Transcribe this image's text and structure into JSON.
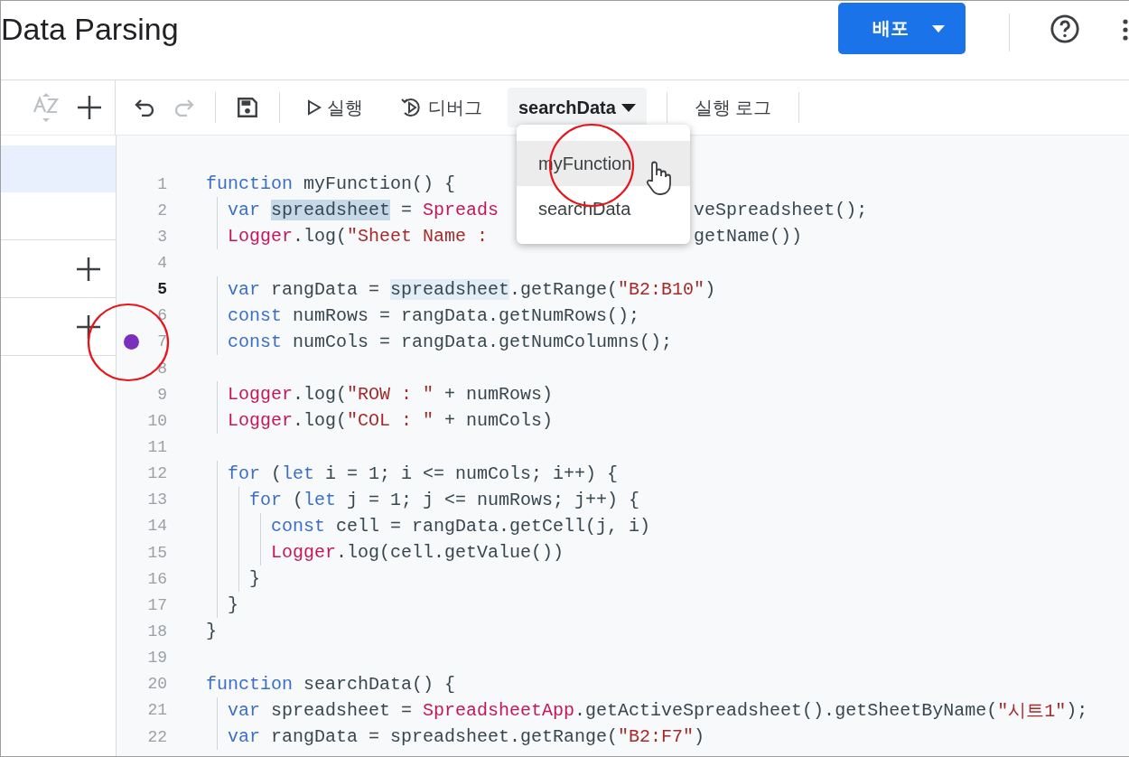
{
  "header": {
    "title": "Data Parsing",
    "deploy_button": "배포"
  },
  "toolbar": {
    "run": "실행",
    "debug": "디버그",
    "function_select": "searchData",
    "log": "실행 로그",
    "redo_disabled": true
  },
  "sidebar": {
    "items": [
      {
        "selected": true
      }
    ]
  },
  "menu": {
    "items": [
      {
        "label": "myFunction",
        "hovered": true
      },
      {
        "label": "searchData",
        "hovered": false
      }
    ]
  },
  "editor": {
    "lines": [
      {
        "number": "1",
        "current": false,
        "breakpoint": false,
        "tokens": [
          {
            "text": "function",
            "kind": "kw"
          },
          {
            "text": " myFunction() {",
            "kind": "plain"
          }
        ]
      },
      {
        "number": "2",
        "current": false,
        "breakpoint": false,
        "tokens": [
          {
            "text": "  var ",
            "kind": "kw"
          },
          {
            "text": "spreadsheet",
            "kind": "selected"
          },
          {
            "text": " = ",
            "kind": "plain"
          },
          {
            "text": "Spreads",
            "kind": "cls"
          }
        ],
        "resume": [
          {
            "text": "veSpreadsheet();",
            "kind": "plain"
          }
        ]
      },
      {
        "number": "3",
        "current": false,
        "breakpoint": false,
        "tokens": [
          {
            "text": "  Logger",
            "kind": "cls"
          },
          {
            "text": ".log(",
            "kind": "plain"
          },
          {
            "text": "\"Sheet Name :",
            "kind": "str"
          }
        ],
        "resume": [
          {
            "text": "getName())",
            "kind": "plain"
          }
        ]
      },
      {
        "number": "4",
        "current": false,
        "breakpoint": false
      },
      {
        "number": "5",
        "current": true,
        "breakpoint": false,
        "tokens": [
          {
            "text": "  var",
            "kind": "kw"
          },
          {
            "text": " rangData = ",
            "kind": "plain"
          },
          {
            "text": "spreadsheet",
            "kind": "match"
          },
          {
            "text": ".getRange(",
            "kind": "plain"
          },
          {
            "text": "\"B2:B10\"",
            "kind": "str"
          },
          {
            "text": ")",
            "kind": "plain"
          }
        ]
      },
      {
        "number": "6",
        "current": false,
        "breakpoint": false,
        "tokens": [
          {
            "text": "  const",
            "kind": "kw"
          },
          {
            "text": " numRows = rangData.getNumRows();",
            "kind": "plain"
          }
        ]
      },
      {
        "number": "7",
        "current": false,
        "breakpoint": true,
        "tokens": [
          {
            "text": "  const",
            "kind": "kw"
          },
          {
            "text": " numCols = rangData.getNumColumns();",
            "kind": "plain"
          }
        ]
      },
      {
        "number": "8",
        "current": false,
        "breakpoint": false
      },
      {
        "number": "9",
        "current": false,
        "breakpoint": false,
        "tokens": [
          {
            "text": "  Logger",
            "kind": "cls"
          },
          {
            "text": ".log(",
            "kind": "plain"
          },
          {
            "text": "\"ROW : \"",
            "kind": "str"
          },
          {
            "text": " + numRows)",
            "kind": "plain"
          }
        ]
      },
      {
        "number": "10",
        "current": false,
        "breakpoint": false,
        "tokens": [
          {
            "text": "  Logger",
            "kind": "cls"
          },
          {
            "text": ".log(",
            "kind": "plain"
          },
          {
            "text": "\"COL : \"",
            "kind": "str"
          },
          {
            "text": " + numCols)",
            "kind": "plain"
          }
        ]
      },
      {
        "number": "11",
        "current": false,
        "breakpoint": false
      },
      {
        "number": "12",
        "current": false,
        "breakpoint": false,
        "tokens": [
          {
            "text": "  for",
            "kind": "kw"
          },
          {
            "text": " (",
            "kind": "plain"
          },
          {
            "text": "let",
            "kind": "kw"
          },
          {
            "text": " i = 1; i <= numCols; i++) {",
            "kind": "plain"
          }
        ]
      },
      {
        "number": "13",
        "current": false,
        "breakpoint": false,
        "tokens": [
          {
            "text": "    for",
            "kind": "kw"
          },
          {
            "text": " (",
            "kind": "plain"
          },
          {
            "text": "let",
            "kind": "kw"
          },
          {
            "text": " j = 1; j <= numRows; j++) {",
            "kind": "plain"
          }
        ]
      },
      {
        "number": "14",
        "current": false,
        "breakpoint": false,
        "tokens": [
          {
            "text": "      const",
            "kind": "kw"
          },
          {
            "text": " cell = rangData.getCell(j, i)",
            "kind": "plain"
          }
        ]
      },
      {
        "number": "15",
        "current": false,
        "breakpoint": false,
        "tokens": [
          {
            "text": "      Logger",
            "kind": "cls"
          },
          {
            "text": ".log(cell.getValue())",
            "kind": "plain"
          }
        ]
      },
      {
        "number": "16",
        "current": false,
        "breakpoint": false,
        "tokens": [
          {
            "text": "    }",
            "kind": "plain"
          }
        ]
      },
      {
        "number": "17",
        "current": false,
        "breakpoint": false,
        "tokens": [
          {
            "text": "  }",
            "kind": "plain"
          }
        ]
      },
      {
        "number": "18",
        "current": false,
        "breakpoint": false,
        "tokens": [
          {
            "text": "}",
            "kind": "plain"
          }
        ]
      },
      {
        "number": "19",
        "current": false,
        "breakpoint": false
      },
      {
        "number": "20",
        "current": false,
        "breakpoint": false,
        "tokens": [
          {
            "text": "function",
            "kind": "kw"
          },
          {
            "text": " searchData() {",
            "kind": "plain"
          }
        ]
      },
      {
        "number": "21",
        "current": false,
        "breakpoint": false,
        "tokens": [
          {
            "text": "  var",
            "kind": "kw"
          },
          {
            "text": " spreadsheet = ",
            "kind": "plain"
          },
          {
            "text": "SpreadsheetApp",
            "kind": "cls"
          },
          {
            "text": ".getActiveSpreadsheet().getSheetByName(",
            "kind": "plain"
          },
          {
            "text": "\"시트1\"",
            "kind": "str"
          },
          {
            "text": ");",
            "kind": "plain"
          }
        ]
      },
      {
        "number": "22",
        "current": false,
        "breakpoint": false,
        "tokens": [
          {
            "text": "  var",
            "kind": "kw"
          },
          {
            "text": " rangData = spreadsheet.getRange(",
            "kind": "plain"
          },
          {
            "text": "\"B2:F7\"",
            "kind": "str"
          },
          {
            "text": ")",
            "kind": "plain"
          }
        ]
      }
    ]
  }
}
